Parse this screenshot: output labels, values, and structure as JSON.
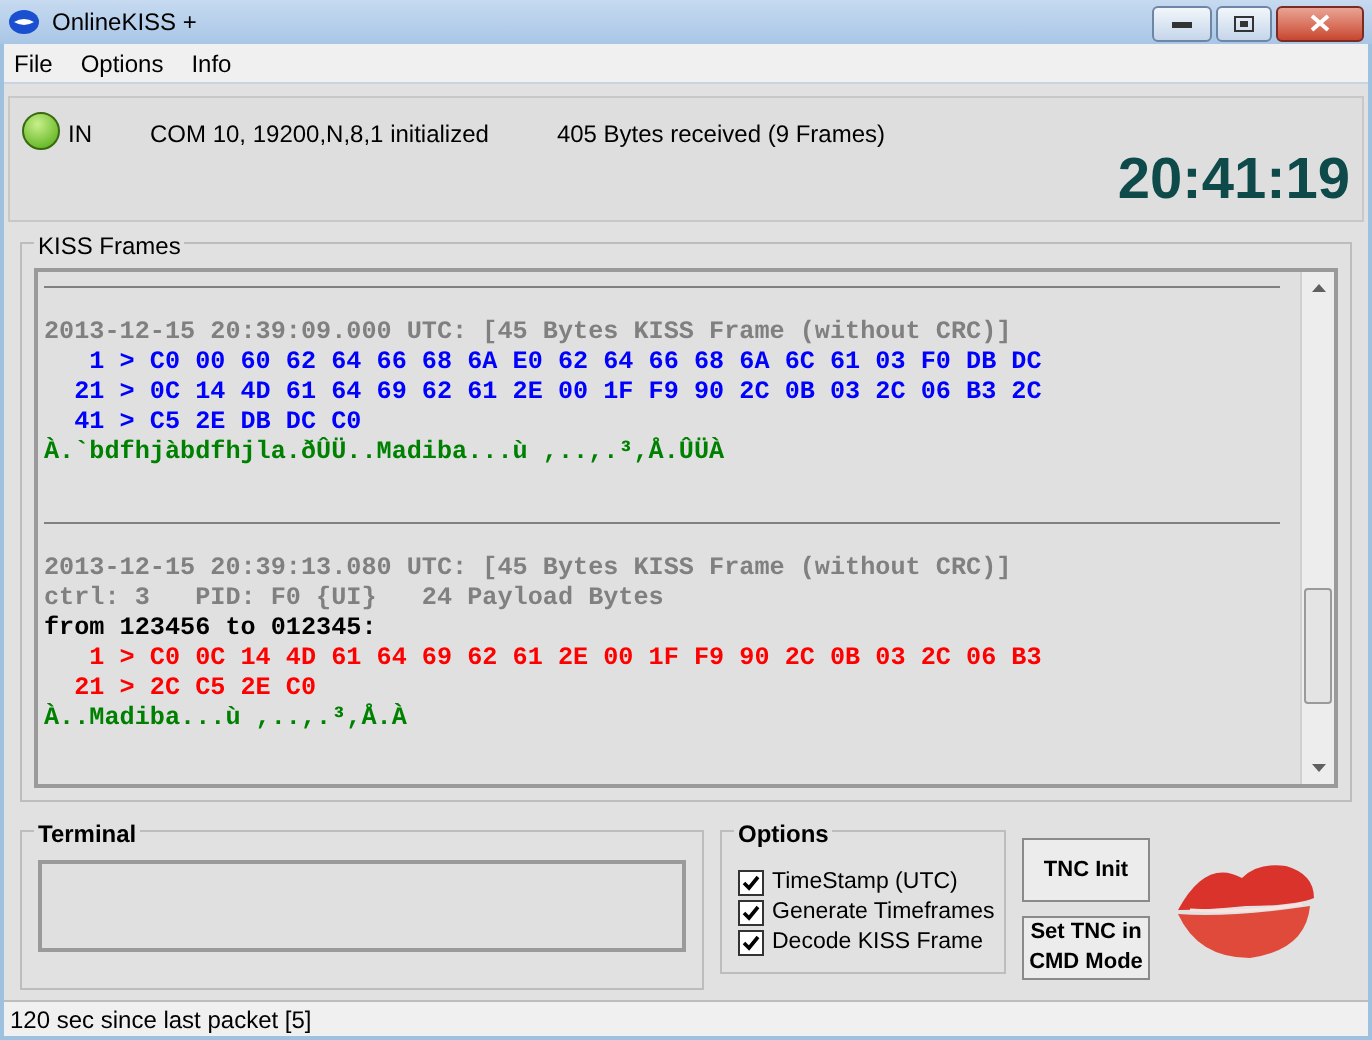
{
  "window": {
    "title": "OnlineKISS +"
  },
  "menu": [
    {
      "label": "File"
    },
    {
      "label": "Options"
    },
    {
      "label": "Info"
    }
  ],
  "status": {
    "led_on": true,
    "led_label": "IN",
    "port": "COM 10, 19200,N,8,1 initialized",
    "received": "405 Bytes received (9 Frames)",
    "clock": "20:41:19"
  },
  "kiss_frames": {
    "title": "KISS Frames",
    "entries": [
      {
        "lines": [
          {
            "kind": "meta",
            "text": "2013-12-15 20:39:09.000 UTC: [45 Bytes KISS Frame (without CRC)]"
          },
          {
            "kind": "hex",
            "color": "#0000ff",
            "text": "   1 > C0 00 60 62 64 66 68 6A E0 62 64 66 68 6A 6C 61 03 F0 DB DC"
          },
          {
            "kind": "hex",
            "color": "#0000ff",
            "text": "  21 > 0C 14 4D 61 64 69 62 61 2E 00 1F F9 90 2C 0B 03 2C 06 B3 2C"
          },
          {
            "kind": "hex",
            "color": "#0000ff",
            "text": "  41 > C5 2E DB DC C0"
          },
          {
            "kind": "ascii",
            "text": "À.`bdfhjàbdfhjla.ðÛÜ..Madiba...ù ,..,.³,Å.ÛÜÀ"
          }
        ]
      },
      {
        "lines": [
          {
            "kind": "meta",
            "text": "2013-12-15 20:39:13.080 UTC: [45 Bytes KISS Frame (without CRC)]"
          },
          {
            "kind": "meta",
            "text": "ctrl: 3   PID: F0 {UI}   24 Payload Bytes"
          },
          {
            "kind": "route",
            "text": "from 123456 to 012345:"
          },
          {
            "kind": "hex",
            "color": "#ff0000",
            "text": "   1 > C0 0C 14 4D 61 64 69 62 61 2E 00 1F F9 90 2C 0B 03 2C 06 B3"
          },
          {
            "kind": "hex",
            "color": "#ff0000",
            "text": "  21 > 2C C5 2E C0"
          },
          {
            "kind": "ascii",
            "text": "À..Madiba...ù ,..,.³,Å.À"
          }
        ]
      }
    ]
  },
  "terminal": {
    "title": "Terminal"
  },
  "options": {
    "title": "Options",
    "items": [
      {
        "label": "TimeStamp (UTC)",
        "checked": true
      },
      {
        "label": "Generate Timeframes",
        "checked": true
      },
      {
        "label": "Decode KISS Frame",
        "checked": true
      }
    ]
  },
  "buttons": [
    {
      "label": "TNC Init"
    },
    {
      "label": "Set TNC in CMD Mode"
    }
  ],
  "status_bar": {
    "text": "120 sec since last packet [5]"
  }
}
